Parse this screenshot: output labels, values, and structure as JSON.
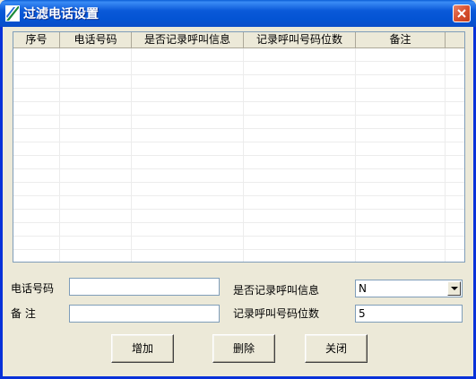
{
  "window": {
    "title": "过滤电话设置",
    "close_label": ""
  },
  "grid": {
    "columns": [
      "序号",
      "电话号码",
      "是否记录呼叫信息",
      "记录呼叫号码位数",
      "备注"
    ],
    "rows": []
  },
  "form": {
    "phone_label": "电话号码",
    "phone_value": "",
    "note_label": "备 注",
    "note_value": "",
    "record_info_label": "是否记录呼叫信息",
    "record_info_value": "N",
    "digits_label": "记录呼叫号码位数",
    "digits_value": "5"
  },
  "buttons": {
    "add": "增加",
    "delete": "删除",
    "close": "关闭"
  },
  "colors": {
    "titlebar": "#0a59d8",
    "window_bg": "#ece9d8",
    "close_button": "#d8512f"
  }
}
